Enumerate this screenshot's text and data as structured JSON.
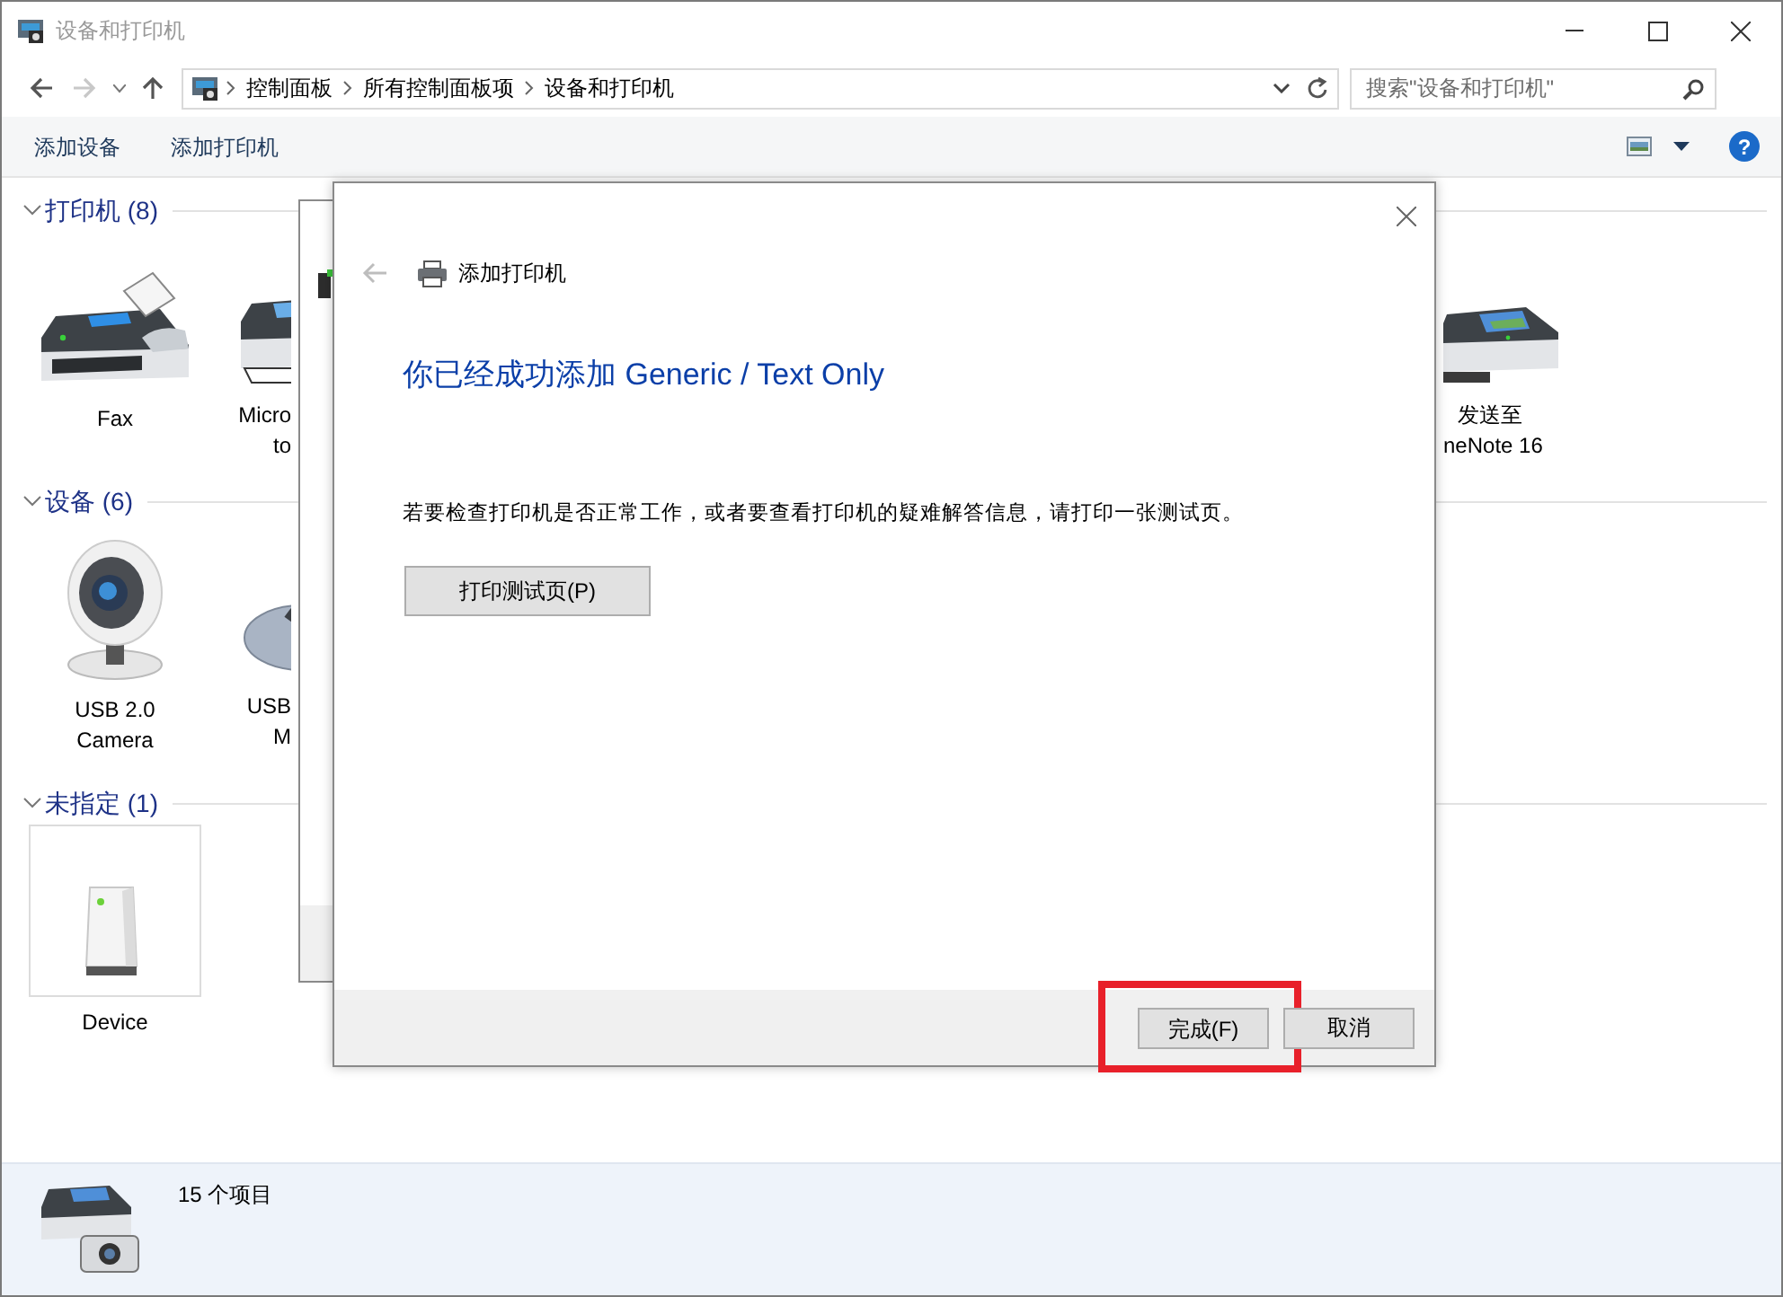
{
  "window": {
    "title": "设备和打印机"
  },
  "nav": {
    "back": {
      "disabled": false
    },
    "forward": {
      "disabled": true
    },
    "up": {
      "disabled": false
    }
  },
  "breadcrumbs": [
    "控制面板",
    "所有控制面板项",
    "设备和打印机"
  ],
  "search": {
    "placeholder": "搜索\"设备和打印机\""
  },
  "toolbar": {
    "buttons": [
      "添加设备",
      "添加打印机"
    ],
    "help": "?"
  },
  "groups": [
    {
      "title": "打印机 (8)",
      "expanded": true,
      "items": [
        {
          "kind": "fax",
          "selected": false,
          "label_lines": [
            "Fax"
          ]
        },
        {
          "kind": "printer",
          "selected": false,
          "label_lines": [
            "Micro",
            "to"
          ]
        },
        {
          "kind": "photo-printer",
          "selected": false,
          "label_lines": [
            "发送至",
            "neNote 16"
          ]
        }
      ]
    },
    {
      "title": "设备 (6)",
      "expanded": true,
      "items": [
        {
          "kind": "webcam",
          "selected": false,
          "label_lines": [
            "USB 2.0",
            "Camera"
          ]
        },
        {
          "kind": "mouse",
          "selected": false,
          "label_lines": [
            "USB",
            "M"
          ]
        }
      ]
    },
    {
      "title": "未指定 (1)",
      "expanded": true,
      "items": [
        {
          "kind": "device",
          "selected": true,
          "label_lines": [
            "Device"
          ]
        }
      ]
    }
  ],
  "status_bar": {
    "text": "15 个项目"
  },
  "dialog": {
    "title": "添加打印机",
    "back_disabled": true,
    "heading": "你已经成功添加 Generic / Text Only",
    "message": "若要检查打印机是否正常工作，或者要查看打印机的疑难解答信息，请打印一张测试页。",
    "test_button": "打印测试页(P)",
    "buttons": [
      {
        "label": "完成(F)",
        "highlighted": true
      },
      {
        "label": "取消",
        "highlighted": false
      }
    ]
  }
}
